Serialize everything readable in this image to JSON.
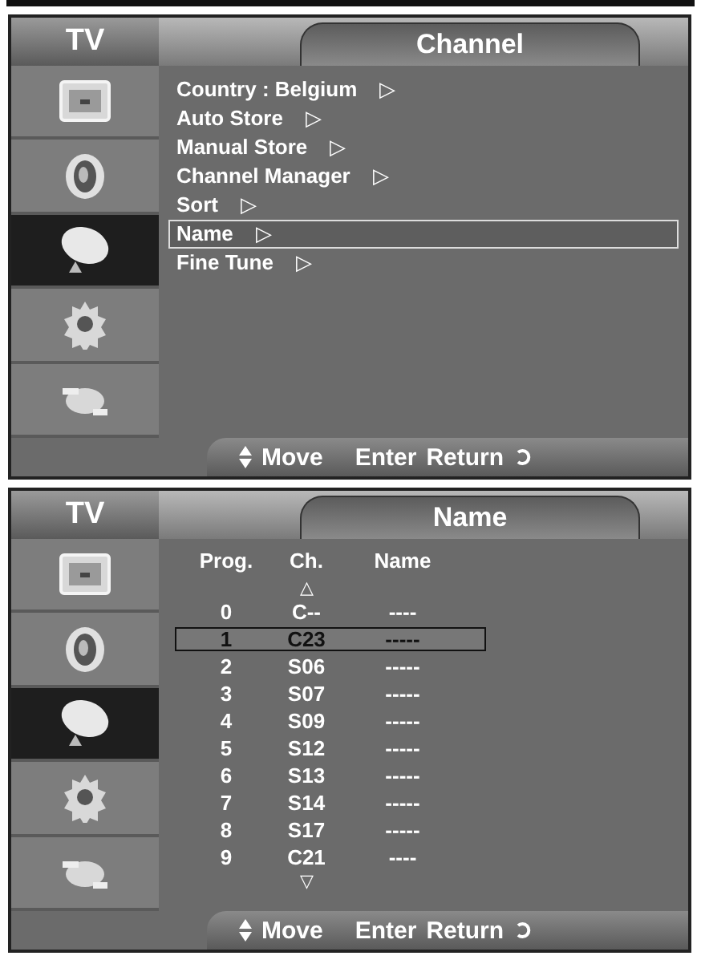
{
  "panels": [
    {
      "kind": "menu",
      "sidebar_title": "TV",
      "title": "Channel",
      "sidebar": [
        {
          "selected": false
        },
        {
          "selected": false
        },
        {
          "selected": true
        },
        {
          "selected": false
        },
        {
          "selected": false
        }
      ],
      "items": [
        {
          "label": "Country  : Belgium",
          "arrow": "▷",
          "selected": false
        },
        {
          "label": "Auto Store",
          "arrow": "▷",
          "selected": false
        },
        {
          "label": "Manual Store",
          "arrow": "▷",
          "selected": false
        },
        {
          "label": "Channel Manager",
          "arrow": "▷",
          "selected": false
        },
        {
          "label": "Sort",
          "arrow": "▷",
          "selected": false
        },
        {
          "label": "Name",
          "arrow": "▷",
          "selected": true
        },
        {
          "label": "Fine Tune",
          "arrow": "▷",
          "selected": false
        }
      ],
      "footer": {
        "move": "Move",
        "enter": "Enter",
        "return": "Return"
      }
    },
    {
      "kind": "table",
      "sidebar_title": "TV",
      "title": "Name",
      "sidebar": [
        {
          "selected": false
        },
        {
          "selected": false
        },
        {
          "selected": true
        },
        {
          "selected": false
        },
        {
          "selected": false
        }
      ],
      "columns": [
        "Prog.",
        "Ch.",
        "Name"
      ],
      "scroll_up": "△",
      "scroll_down": "▽",
      "rows": [
        {
          "prog": "0",
          "ch": "C--",
          "name": "----",
          "selected": false
        },
        {
          "prog": "1",
          "ch": "C23",
          "name": "-----",
          "selected": true
        },
        {
          "prog": "2",
          "ch": "S06",
          "name": "-----",
          "selected": false
        },
        {
          "prog": "3",
          "ch": "S07",
          "name": "-----",
          "selected": false
        },
        {
          "prog": "4",
          "ch": "S09",
          "name": "-----",
          "selected": false
        },
        {
          "prog": "5",
          "ch": "S12",
          "name": "-----",
          "selected": false
        },
        {
          "prog": "6",
          "ch": "S13",
          "name": "-----",
          "selected": false
        },
        {
          "prog": "7",
          "ch": "S14",
          "name": "-----",
          "selected": false
        },
        {
          "prog": "8",
          "ch": "S17",
          "name": "-----",
          "selected": false
        },
        {
          "prog": "9",
          "ch": "C21",
          "name": "----",
          "selected": false
        }
      ],
      "footer": {
        "move": "Move",
        "enter": "Enter",
        "return": "Return"
      }
    }
  ]
}
